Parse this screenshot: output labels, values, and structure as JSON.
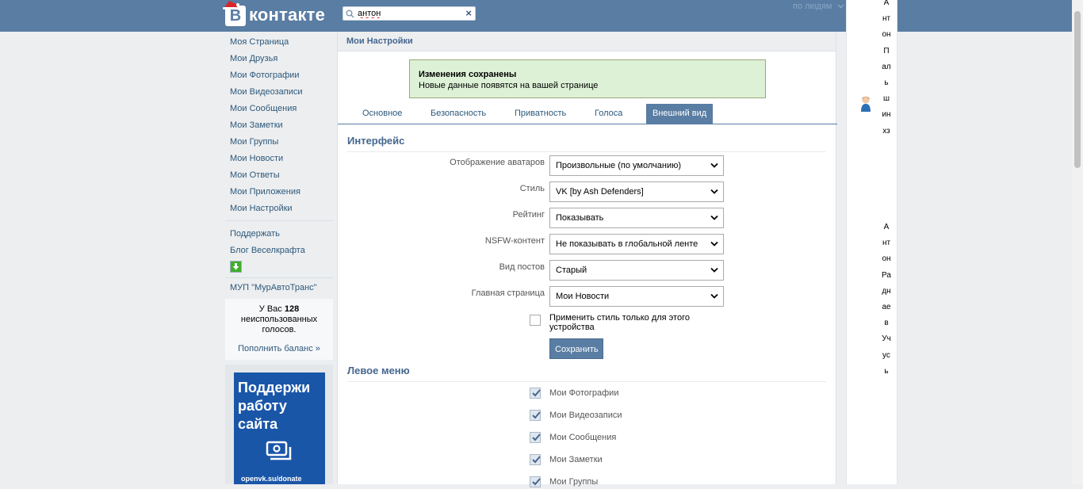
{
  "header": {
    "logo_letter": "В",
    "logo_text": "контакте",
    "search_value": "антон",
    "search_filter": "по людям"
  },
  "sidebar": {
    "items": [
      {
        "label": "Моя Страница"
      },
      {
        "label": "Мои Друзья"
      },
      {
        "label": "Мои Фотографии"
      },
      {
        "label": "Мои Видеозаписи"
      },
      {
        "label": "Мои Сообщения"
      },
      {
        "label": "Мои Заметки"
      },
      {
        "label": "Мои Группы"
      },
      {
        "label": "Мои Новости"
      },
      {
        "label": "Мои Ответы"
      },
      {
        "label": "Мои Приложения"
      },
      {
        "label": "Мои Настройки"
      }
    ],
    "extra": [
      {
        "label": "Поддержать"
      },
      {
        "label": "Блог Веселкрафта"
      }
    ],
    "org": "МУП \"МурАвтоТранс\"",
    "votes": {
      "prefix": "У Вас",
      "count": "128",
      "suffix": "неиспользованных голосов.",
      "link": "Пополнить баланс »"
    },
    "ad": {
      "title_line1": "Поддержи",
      "title_line2": "работу",
      "title_line3": "сайта",
      "url": "openvk.su/donate"
    }
  },
  "main": {
    "header": "Мои Настройки",
    "notice": {
      "title": "Изменения сохранены",
      "text": "Новые данные появятся на вашей странице"
    },
    "tabs": [
      {
        "label": "Основное"
      },
      {
        "label": "Безопасность"
      },
      {
        "label": "Приватность"
      },
      {
        "label": "Голоса"
      },
      {
        "label": "Внешний вид",
        "active": true
      }
    ],
    "interface_title": "Интерфейс",
    "fields": [
      {
        "label": "Отображение аватаров",
        "value": "Произвольные (по умолчанию)"
      },
      {
        "label": "Стиль",
        "value": "VK [by Ash Defenders]"
      },
      {
        "label": "Рейтинг",
        "value": "Показывать"
      },
      {
        "label": "NSFW-контент",
        "value": "Не показывать в глобальной ленте"
      },
      {
        "label": "Вид постов",
        "value": "Старый"
      },
      {
        "label": "Главная страница",
        "value": "Мои Новости"
      }
    ],
    "device_only_label": "Применить стиль только для этого устройства",
    "device_only_checked": false,
    "save_label": "Сохранить",
    "left_menu_title": "Левое меню",
    "left_menu_items": [
      {
        "label": "Мои Фотографии",
        "checked": true
      },
      {
        "label": "Мои Видеозаписи",
        "checked": true
      },
      {
        "label": "Мои Сообщения",
        "checked": true
      },
      {
        "label": "Мои Заметки",
        "checked": true
      },
      {
        "label": "Мои Группы",
        "checked": true
      }
    ]
  },
  "chat": {
    "friends": [
      "Антон Пальшин хз",
      "Антон Раднаев Учусь"
    ]
  },
  "colors": {
    "header_bg": "#597da3",
    "link": "#2b587a",
    "notice_bg": "#ddf1d6",
    "button_bg": "#597da3"
  }
}
